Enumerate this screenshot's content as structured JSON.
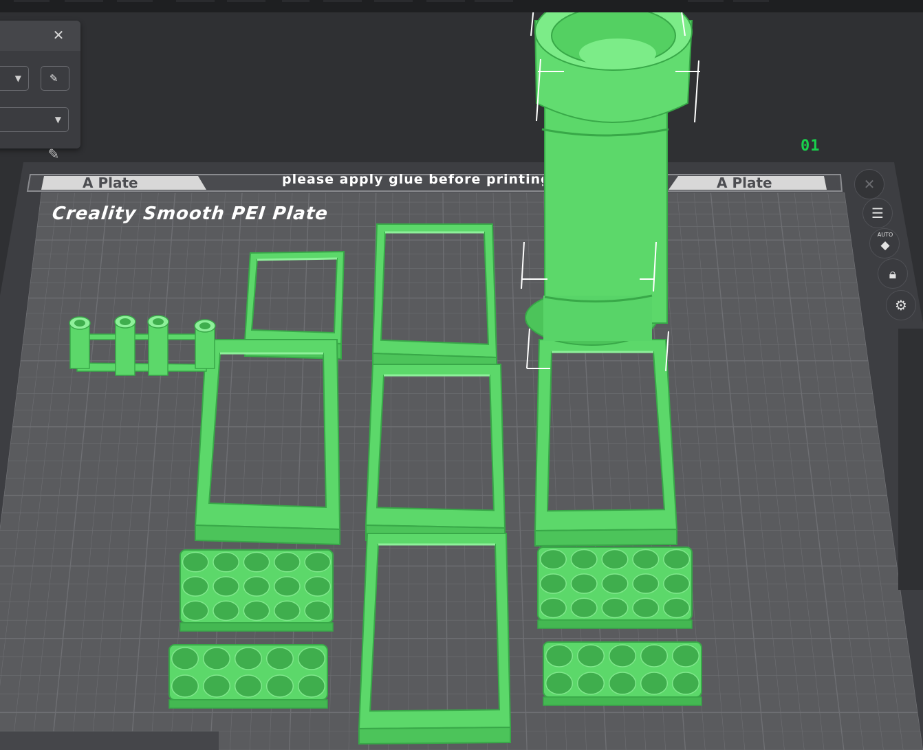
{
  "plate": {
    "number": "01",
    "left_tab_label": "A Plate",
    "right_tab_label": "A Plate",
    "notice": "please apply glue before printing",
    "surface_name": "Creality Smooth PEI Plate"
  },
  "panel": {
    "close_icon": "close-icon",
    "dropdown_caret_icon": "chevron-down-icon",
    "edit_icon": "pencil-icon"
  },
  "toolbar": {
    "icons": [
      "close-icon",
      "list-icon",
      "auto-orient-icon",
      "lock-icon",
      "gear-icon"
    ],
    "auto_label": "AUTO"
  },
  "colors": {
    "background": "#2f3033",
    "bed": "#5a5b5e",
    "grid": "#6e6f73",
    "model_fill": "#5cd86a",
    "model_edge": "#38a848",
    "plate_number": "#19d04c",
    "plate_title": "#ffffff"
  },
  "objects": [
    {
      "name": "filament-spool-holder-tube",
      "kind": "cylinder"
    },
    {
      "name": "pen-holder-rack",
      "kind": "rack"
    },
    {
      "name": "case-frame-1",
      "kind": "frame"
    },
    {
      "name": "case-frame-2",
      "kind": "frame"
    },
    {
      "name": "case-frame-3",
      "kind": "frame"
    },
    {
      "name": "case-frame-4",
      "kind": "frame"
    },
    {
      "name": "case-frame-5",
      "kind": "frame"
    },
    {
      "name": "case-frame-6",
      "kind": "frame"
    },
    {
      "name": "battery-tray-1",
      "kind": "tray"
    },
    {
      "name": "battery-tray-2",
      "kind": "tray"
    },
    {
      "name": "battery-tray-3",
      "kind": "tray"
    },
    {
      "name": "battery-tray-4",
      "kind": "tray"
    }
  ]
}
